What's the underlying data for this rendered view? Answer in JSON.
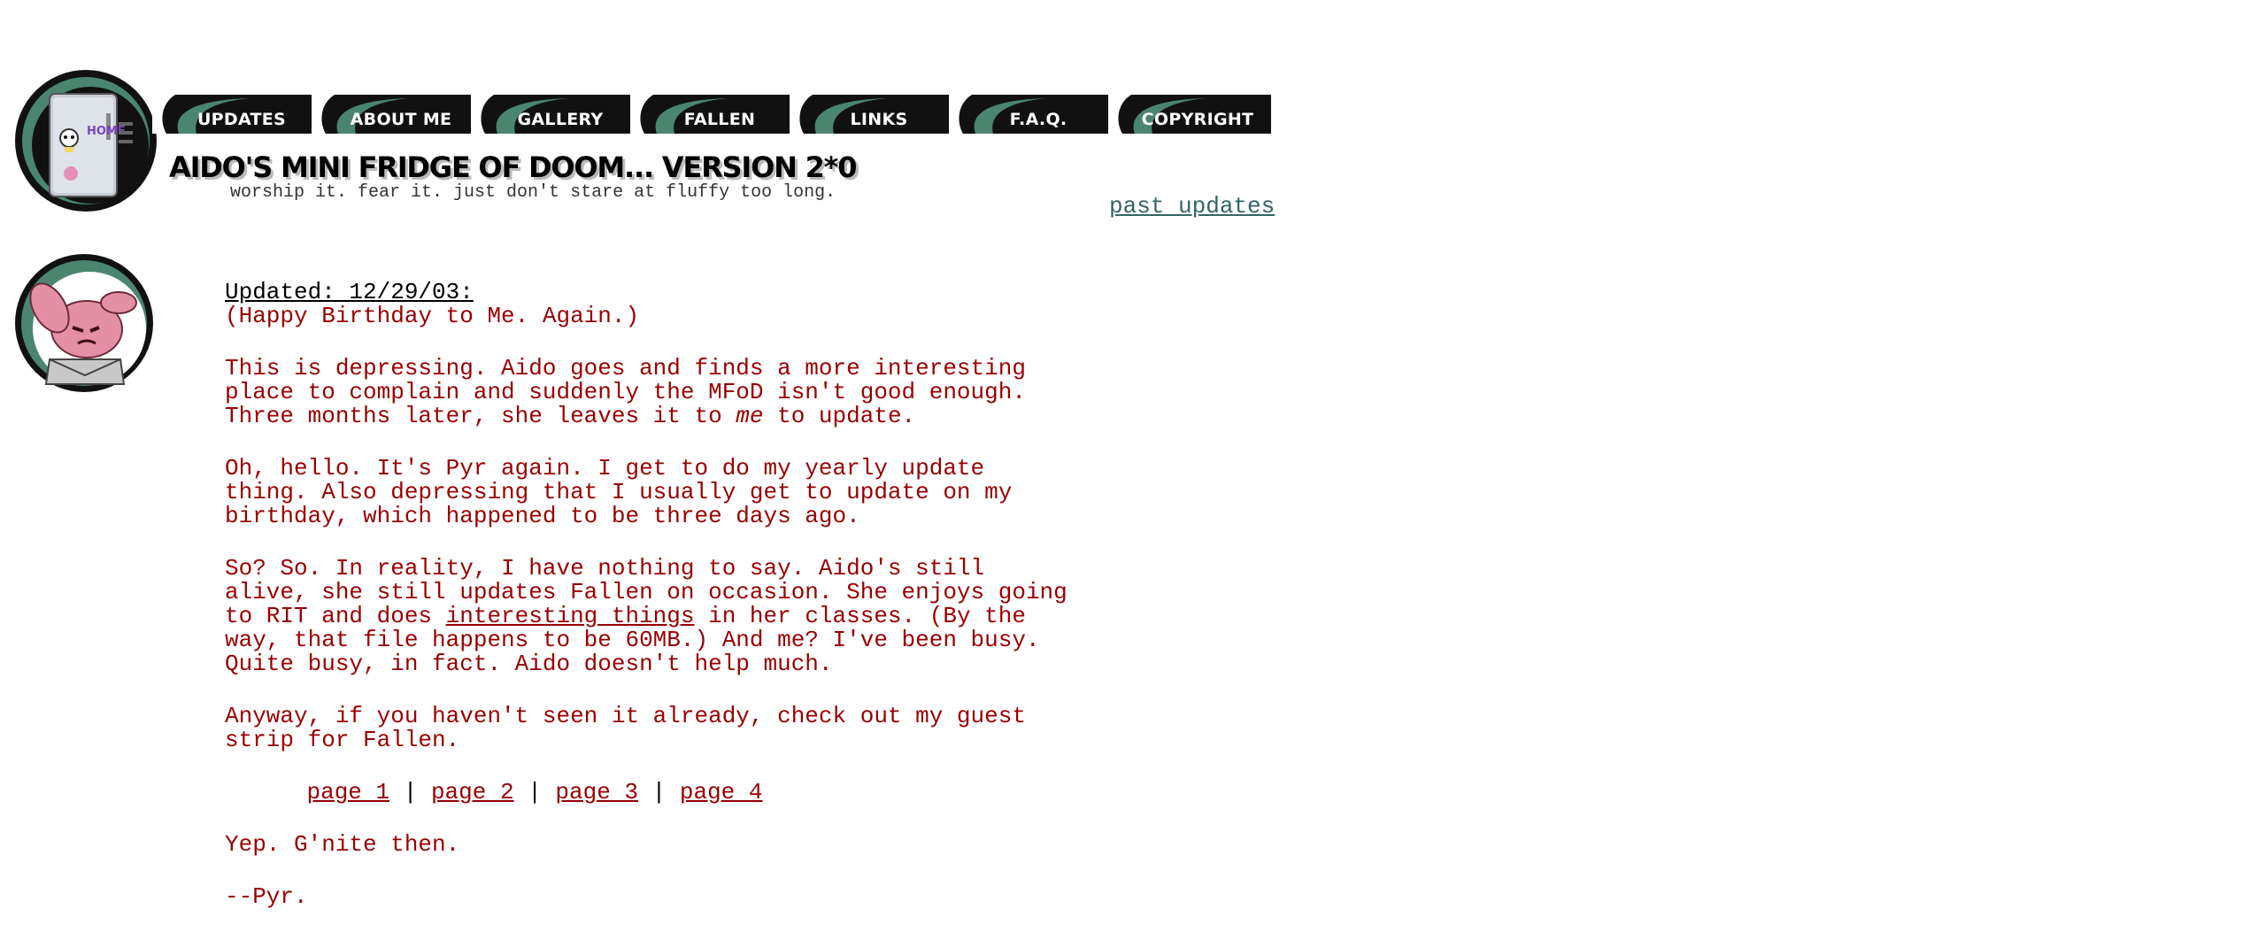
{
  "colors": {
    "text": "#990000",
    "link_past_updates": "#336666",
    "nav_bg": "#111111",
    "nav_swoosh": "#4a8570"
  },
  "header": {
    "nav": [
      {
        "label": "UPDATES"
      },
      {
        "label": "ABOUT ME"
      },
      {
        "label": "GALLERY"
      },
      {
        "label": "FALLEN"
      },
      {
        "label": "LINKS"
      },
      {
        "label": "F.A.Q."
      },
      {
        "label": "COPYRIGHT"
      }
    ],
    "title": "AIDO'S MINI FRIDGE OF DOOM... VERSION 2*0",
    "tagline": "worship it. fear it.  just don't stare at fluffy too long.",
    "past_updates": "past updates",
    "logo_icon": "fridge-logo-icon",
    "logo_magnets": "HOME"
  },
  "post": {
    "updated": "Updated: 12/29/03:",
    "subtitle": "(Happy Birthday to Me. Again.)",
    "p1_a": "This is depressing. Aido goes and finds a more interesting place to complain and suddenly the MFoD isn't good enough. Three months later, she leaves it to ",
    "p1_em": "me",
    "p1_b": " to update.",
    "p2": "Oh, hello. It's Pyr again. I get to do my yearly update thing. Also depressing that I usually get to update on my birthday, which happened to be three days ago.",
    "p3_a": "So? So. In reality, I have nothing to say. Aido's still alive, she still updates Fallen on occasion. She enjoys going to RIT and does ",
    "p3_link": "interesting things",
    "p3_b": " in her classes. (By the way, that file happens to be 60MB.) And me? I've been busy. Quite busy, in fact. Aido doesn't help much.",
    "p4": "Anyway, if you haven't seen it already, check out my guest strip for Fallen.",
    "pages": [
      "page 1",
      "page 2",
      "page 3",
      "page 4"
    ],
    "separator": "|",
    "p5": "Yep. G'nite then.",
    "signature": "--Pyr.",
    "avatar_icon": "pink-creature-avatar-icon"
  }
}
